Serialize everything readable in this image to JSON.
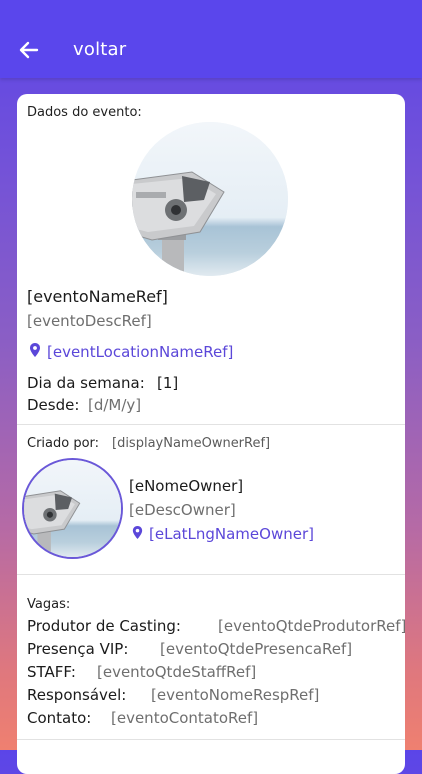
{
  "header": {
    "back_label": "voltar"
  },
  "event": {
    "section_title": "Dados do evento:",
    "name": "[eventoNameRef]",
    "description": "[eventoDescRef]",
    "location": "[eventLocationNameRef]",
    "weekday_label": "Dia da semana:",
    "weekday_value": "[1]",
    "since_label": "Desde:",
    "since_value": "[d/M/y]"
  },
  "owner": {
    "section_label": "Criado por:",
    "display_name": "[displayNameOwnerRef]",
    "name": "[eNomeOwner]",
    "description": "[eDescOwner]",
    "location": "[eLatLngNameOwner]"
  },
  "vacancies": {
    "section_title": "Vagas:",
    "rows": [
      {
        "label": "Produtor de Casting:",
        "value": "[eventoQtdeProdutorRef]"
      },
      {
        "label": "Presença VIP:",
        "value": "[eventoQtdePresencaRef]"
      },
      {
        "label": "STAFF:",
        "value": "[eventoQtdeStaffRef]"
      },
      {
        "label": "Responsável:",
        "value": "[eventoNomeRespRef]"
      },
      {
        "label": "Contato:",
        "value": "[eventoContatoRef]"
      }
    ]
  },
  "icons": {
    "back": "arrow-left-icon",
    "location": "map-pin-icon"
  },
  "colors": {
    "header": "#5a46ec",
    "accent": "#5b47d9",
    "card": "#ffffff"
  }
}
